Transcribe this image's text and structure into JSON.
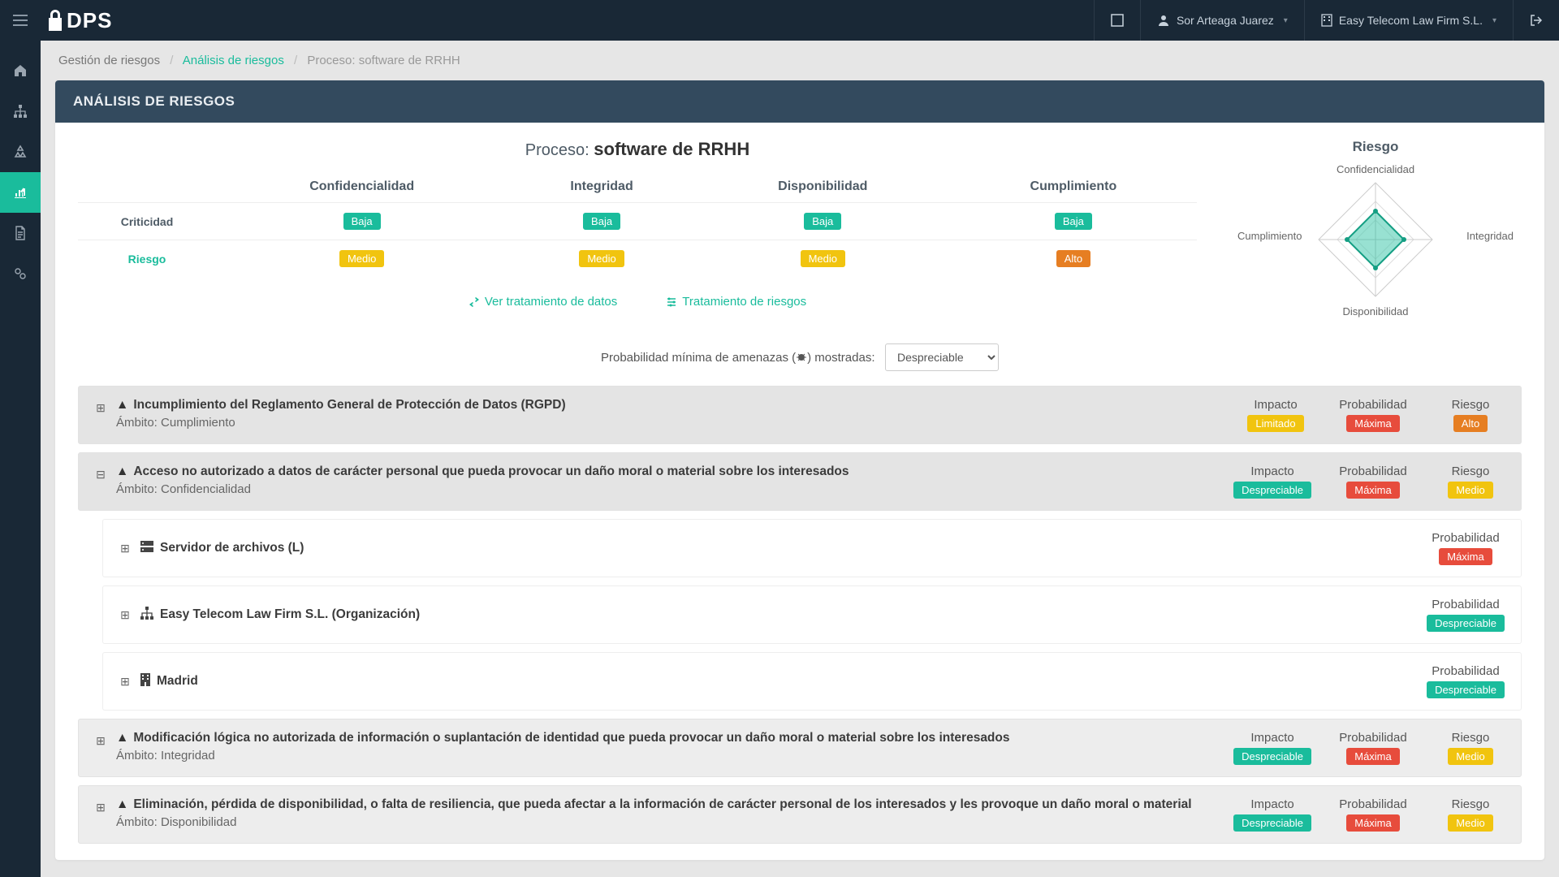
{
  "header": {
    "brand": "DPS",
    "user": "Sor Arteaga Juarez",
    "org": "Easy Telecom Law Firm S.L."
  },
  "breadcrumb": {
    "root": "Gestión de riesgos",
    "mid": "Análisis de riesgos",
    "current": "Proceso: software de RRHH"
  },
  "panel_title": "ANÁLISIS DE RIESGOS",
  "proceso_label": "Proceso:",
  "proceso_name": "software de RRHH",
  "columns": {
    "conf": "Confidencialidad",
    "integ": "Integridad",
    "disp": "Disponibilidad",
    "cump": "Cumplimiento"
  },
  "rows": {
    "crit": "Criticidad",
    "riesgo": "Riesgo"
  },
  "grid": {
    "crit": {
      "conf": "Baja",
      "integ": "Baja",
      "disp": "Baja",
      "cump": "Baja"
    },
    "riesgo": {
      "conf": "Medio",
      "integ": "Medio",
      "disp": "Medio",
      "cump": "Alto"
    }
  },
  "links": {
    "ver": "Ver tratamiento de datos",
    "trat": "Tratamiento de riesgos"
  },
  "prob_filter": {
    "label_pre": "Probabilidad mínima de amenazas (",
    "label_post": ") mostradas:",
    "selected": "Despreciable"
  },
  "chart_title": "Riesgo",
  "chart_data": {
    "type": "radar",
    "axes": [
      "Confidencialidad",
      "Integridad",
      "Disponibilidad",
      "Cumplimiento"
    ],
    "scale_max": 3,
    "series": [
      {
        "name": "Riesgo",
        "values": [
          1.5,
          1.5,
          1.5,
          1.5
        ],
        "color": "#1abc9c"
      }
    ]
  },
  "labels": {
    "impacto": "Impacto",
    "prob": "Probabilidad",
    "riesgo": "Riesgo",
    "ambito": "Ámbito:"
  },
  "threats": [
    {
      "expanded": false,
      "title": "Incumplimiento del Reglamento General de Protección de Datos (RGPD)",
      "ambito": "Cumplimiento",
      "impacto": {
        "text": "Limitado",
        "color": "yellow"
      },
      "prob": {
        "text": "Máxima",
        "color": "red"
      },
      "riesgo": {
        "text": "Alto",
        "color": "orange"
      }
    },
    {
      "expanded": true,
      "title": "Acceso no autorizado a datos de carácter personal que pueda provocar un daño moral o material sobre los interesados",
      "ambito": "Confidencialidad",
      "impacto": {
        "text": "Despreciable",
        "color": "green"
      },
      "prob": {
        "text": "Máxima",
        "color": "red"
      },
      "riesgo": {
        "text": "Medio",
        "color": "yellow"
      },
      "assets": [
        {
          "icon": "server",
          "title": "Servidor de archivos (L)",
          "prob": {
            "text": "Máxima",
            "color": "red"
          }
        },
        {
          "icon": "org",
          "title": "Easy Telecom Law Firm S.L. (Organización)",
          "prob": {
            "text": "Despreciable",
            "color": "green"
          }
        },
        {
          "icon": "building",
          "title": "Madrid",
          "prob": {
            "text": "Despreciable",
            "color": "green"
          }
        }
      ]
    },
    {
      "expanded": false,
      "title": "Modificación lógica no autorizada de información o suplantación de identidad que pueda provocar un daño moral o material sobre los interesados",
      "ambito": "Integridad",
      "impacto": {
        "text": "Despreciable",
        "color": "green"
      },
      "prob": {
        "text": "Máxima",
        "color": "red"
      },
      "riesgo": {
        "text": "Medio",
        "color": "yellow"
      }
    },
    {
      "expanded": false,
      "title": "Eliminación, pérdida de disponibilidad, o falta de resiliencia, que pueda afectar a la información de carácter personal de los interesados y les provoque un daño moral o material",
      "ambito": "Disponibilidad",
      "impacto": {
        "text": "Despreciable",
        "color": "green"
      },
      "prob": {
        "text": "Máxima",
        "color": "red"
      },
      "riesgo": {
        "text": "Medio",
        "color": "yellow"
      }
    }
  ]
}
